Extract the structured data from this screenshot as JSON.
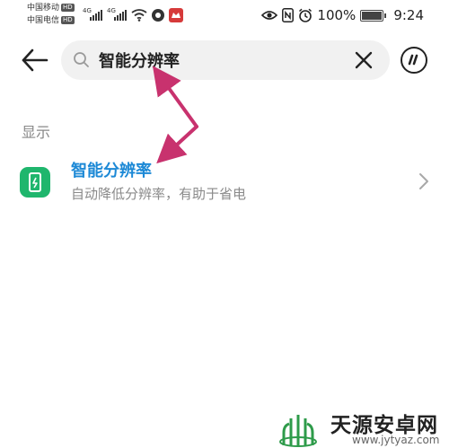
{
  "status_bar": {
    "carrier_1": "中国移动",
    "carrier_2": "中国电信",
    "hd_badge": "HD",
    "network_type": "4G",
    "battery": "100%",
    "time": "9:24",
    "icons": [
      "signal-icon",
      "wifi-icon",
      "app-notification-icon",
      "eye-comfort-icon",
      "nfc-icon",
      "alarm-icon",
      "battery-icon"
    ]
  },
  "search": {
    "query": "智能分辨率",
    "back_icon": "arrow-left-icon",
    "search_icon": "search-icon",
    "clear_icon": "close-icon",
    "voice_icon": "voice-assistant-icon"
  },
  "results": {
    "section_label": "显示",
    "items": [
      {
        "title": "智能分辨率",
        "subtitle": "自动降低分辨率，有助于省电",
        "icon": "phone-resolution-icon",
        "icon_color": "#1fb66d"
      }
    ]
  },
  "watermark": {
    "name": "天源安卓网",
    "url": "www.jytyaz.com"
  },
  "colors": {
    "accent": "#1d89d6",
    "annotation_arrow": "#c8326e",
    "icon_green": "#1fb66d"
  }
}
